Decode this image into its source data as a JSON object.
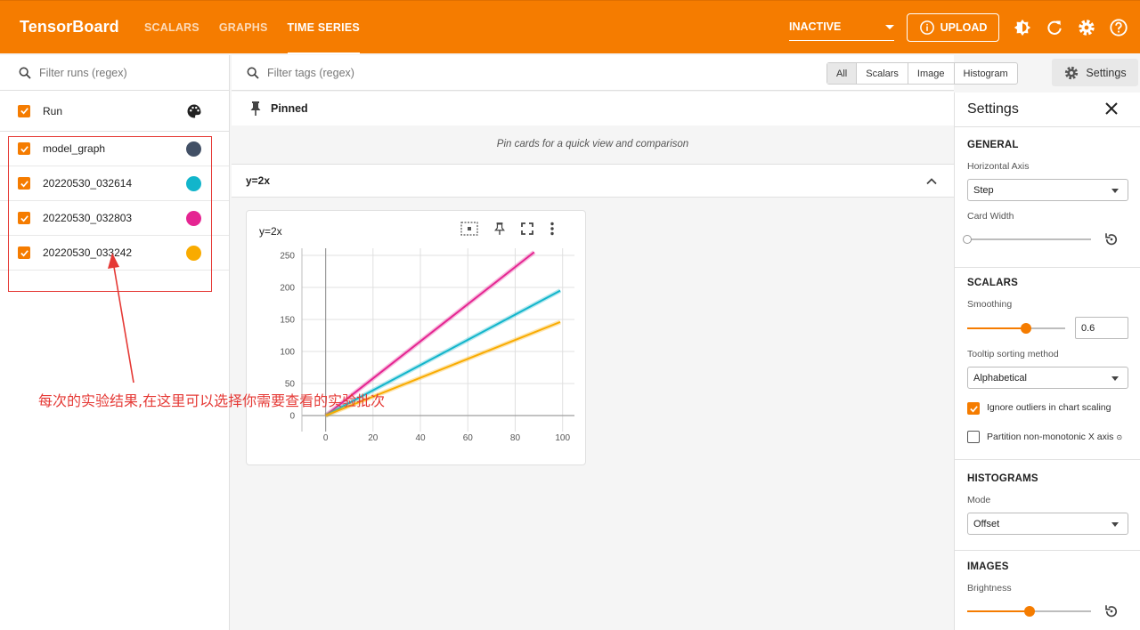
{
  "app": {
    "brand": "TensorBoard"
  },
  "nav": {
    "tabs": [
      "SCALARS",
      "GRAPHS",
      "TIME SERIES"
    ],
    "active": "TIME SERIES"
  },
  "topbar": {
    "mode_select": "INACTIVE",
    "upload_label": "UPLOAD"
  },
  "runs": {
    "filter_placeholder": "Filter runs (regex)",
    "header_label": "Run",
    "items": [
      {
        "name": "model_graph",
        "color": "#425066"
      },
      {
        "name": "20220530_032614",
        "color": "#12b5cb"
      },
      {
        "name": "20220530_032803",
        "color": "#e52592"
      },
      {
        "name": "20220530_033242",
        "color": "#f9ab00"
      }
    ]
  },
  "tags": {
    "filter_placeholder": "Filter tags (regex)",
    "type_filters": [
      "All",
      "Scalars",
      "Image",
      "Histogram"
    ],
    "selected_filter": "All"
  },
  "settings_button_label": "Settings",
  "pinned": {
    "label": "Pinned",
    "hint": "Pin cards for a quick view and comparison"
  },
  "group": {
    "name": "y=2x"
  },
  "card": {
    "title": "y=2x"
  },
  "chart_data": {
    "type": "line",
    "title": "y=2x",
    "xlim": [
      -10,
      105
    ],
    "ylim": [
      -10,
      255
    ],
    "x_ticks": [
      0,
      20,
      40,
      60,
      80,
      100
    ],
    "y_ticks": [
      0,
      50,
      100,
      150,
      200,
      250
    ],
    "grid": true,
    "series": [
      {
        "name": "20220530_032803",
        "color": "#e52592",
        "x": [
          0,
          88
        ],
        "y": [
          0,
          255
        ]
      },
      {
        "name": "20220530_032614",
        "color": "#12b5cb",
        "x": [
          0,
          99
        ],
        "y": [
          0,
          195
        ]
      },
      {
        "name": "20220530_033242",
        "color": "#f9ab00",
        "x": [
          0,
          99
        ],
        "y": [
          0,
          146
        ]
      }
    ]
  },
  "settings": {
    "title": "Settings",
    "general": {
      "heading": "GENERAL",
      "horizontal_axis_label": "Horizontal Axis",
      "horizontal_axis_value": "Step",
      "card_width_label": "Card Width",
      "card_width_level": 0
    },
    "scalars": {
      "heading": "SCALARS",
      "smoothing_label": "Smoothing",
      "smoothing_value": "0.6",
      "smoothing_level": 0.6,
      "tooltip_label": "Tooltip sorting method",
      "tooltip_value": "Alphabetical",
      "ignore_outliers_label": "Ignore outliers in chart scaling",
      "ignore_outliers_checked": true,
      "partition_label": "Partition non-monotonic X axis",
      "partition_checked": false
    },
    "histograms": {
      "heading": "HISTOGRAMS",
      "mode_label": "Mode",
      "mode_value": "Offset"
    },
    "images": {
      "heading": "IMAGES",
      "brightness_label": "Brightness",
      "brightness_level": 0.5
    }
  },
  "annotation": "每次的实验结果,在这里可以选择你需要查看的实验批次"
}
